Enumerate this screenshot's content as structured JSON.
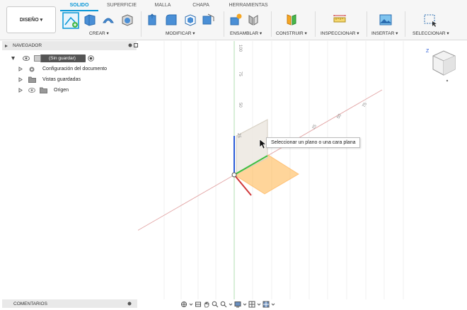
{
  "toolbar": {
    "workspace": "DISEÑO ▾",
    "tabs": [
      "SOLIDO",
      "SUPERFICIE",
      "MALLA",
      "CHAPA",
      "HERRAMIENTAS"
    ],
    "groups": [
      "CREAR ▾",
      "MODIFICAR ▾",
      "ENSAMBLAR ▾",
      "CONSTRUIR ▾",
      "INSPECCIONAR ▾",
      "INSERTAR ▾",
      "SELECCIONAR ▾"
    ]
  },
  "navigator": {
    "title": "NAVEGADOR",
    "root": "(Sin guardar)",
    "items": [
      "Configuración del documento",
      "Vistas guardadas",
      "Origen"
    ]
  },
  "comments": {
    "title": "COMENTARIOS"
  },
  "viewport": {
    "tooltip": "Seleccionar un plano o una cara plana",
    "viewcube": {
      "axis_label": "Z"
    },
    "ruler_y": [
      "100",
      "75",
      "50",
      "25"
    ],
    "ruler_x": [
      "25",
      "50",
      "75"
    ]
  },
  "colors": {
    "accent": "#0696d7",
    "x_axis": "#d0383a",
    "y_axis": "#3fbf3f",
    "z_axis": "#2a5bd7",
    "xy_plane": "#ffb347"
  }
}
